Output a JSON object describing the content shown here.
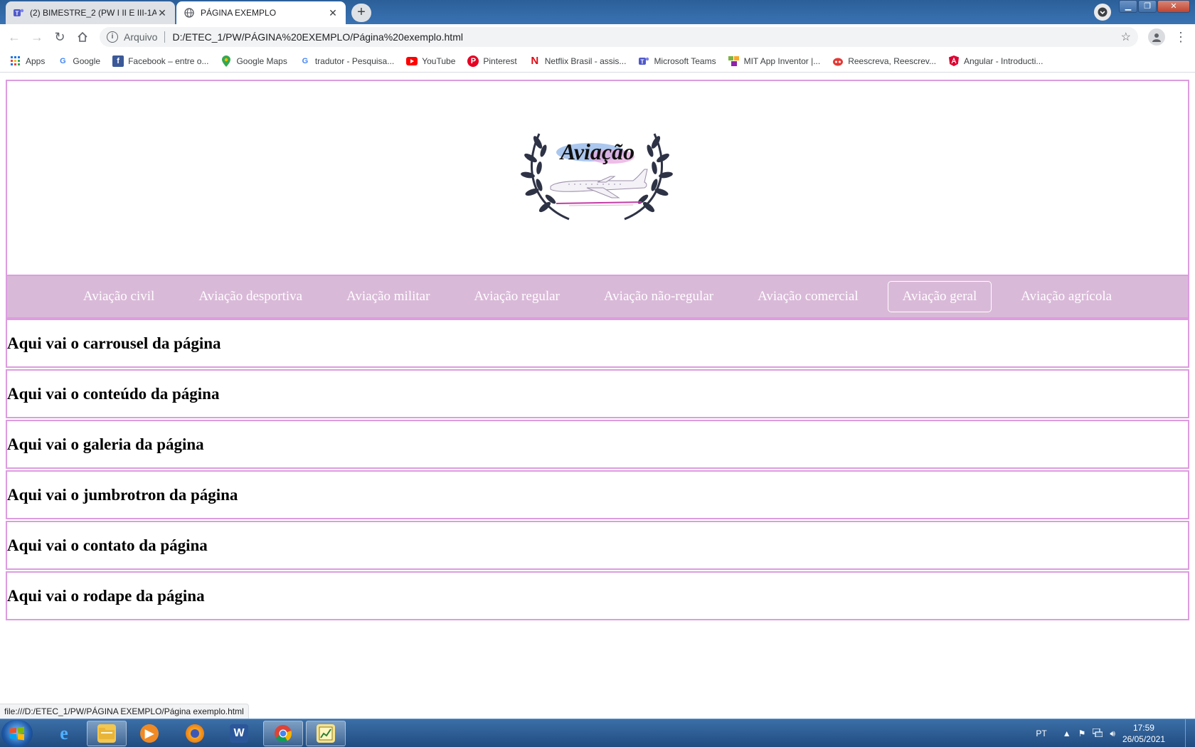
{
  "browser": {
    "tabs": [
      {
        "title": "(2) BIMESTRE_2 (PW I II E III-1A-C",
        "icon": "microsoft-teams-icon",
        "active": false
      },
      {
        "title": "PÁGINA EXEMPLO",
        "icon": "globe-icon",
        "active": true
      }
    ],
    "address": {
      "scheme_label": "Arquivo",
      "url": "D:/ETEC_1/PW/PÁGINA%20EXEMPLO/Página%20exemplo.html"
    },
    "bookmarks": [
      {
        "label": "Apps",
        "icon": "apps-grid-icon"
      },
      {
        "label": "Google",
        "icon": "google-icon"
      },
      {
        "label": "Facebook – entre o...",
        "icon": "facebook-icon"
      },
      {
        "label": "Google Maps",
        "icon": "maps-pin-icon"
      },
      {
        "label": "tradutor - Pesquisa...",
        "icon": "google-icon"
      },
      {
        "label": "YouTube",
        "icon": "youtube-icon"
      },
      {
        "label": "Pinterest",
        "icon": "pinterest-icon"
      },
      {
        "label": "Netflix Brasil - assis...",
        "icon": "netflix-icon"
      },
      {
        "label": "Microsoft Teams",
        "icon": "microsoft-teams-icon"
      },
      {
        "label": "MIT App Inventor |...",
        "icon": "app-inventor-icon"
      },
      {
        "label": "Reescreva, Reescrev...",
        "icon": "reescreva-icon"
      },
      {
        "label": "Angular - Introducti...",
        "icon": "angular-icon"
      }
    ],
    "status_url": "file:///D:/ETEC_1/PW/PÁGINA EXEMPLO/Página exemplo.html"
  },
  "page": {
    "logo_text": "Aviação",
    "nav": [
      {
        "label": "Aviação civil",
        "active": false
      },
      {
        "label": "Aviação desportiva",
        "active": false
      },
      {
        "label": "Aviação militar",
        "active": false
      },
      {
        "label": "Aviação regular",
        "active": false
      },
      {
        "label": "Aviação não-regular",
        "active": false
      },
      {
        "label": "Aviação comercial",
        "active": false
      },
      {
        "label": "Aviação geral",
        "active": true
      },
      {
        "label": "Aviação agrícola",
        "active": false
      }
    ],
    "sections": [
      {
        "heading": "Aqui vai o carrousel da página"
      },
      {
        "heading": "Aqui vai o conteúdo da página"
      },
      {
        "heading": "Aqui vai o galeria da página"
      },
      {
        "heading": "Aqui vai o jumbrotron da página"
      },
      {
        "heading": "Aqui vai o contato da página"
      },
      {
        "heading": "Aqui vai o rodape da página"
      }
    ],
    "colors": {
      "border": "#dd9ce0",
      "nav_background": "#d9b9d8",
      "nav_text": "#ffffff"
    }
  },
  "taskbar": {
    "apps": [
      {
        "icon": "internet-explorer-icon",
        "open": false
      },
      {
        "icon": "file-explorer-icon",
        "open": true
      },
      {
        "icon": "media-player-icon",
        "open": false
      },
      {
        "icon": "firefox-icon",
        "open": false
      },
      {
        "icon": "word-icon",
        "open": false
      },
      {
        "icon": "chrome-icon",
        "open": true
      },
      {
        "icon": "notepad-chart-icon",
        "open": true
      }
    ],
    "language": "PT",
    "time": "17:59",
    "date": "26/05/2021"
  }
}
